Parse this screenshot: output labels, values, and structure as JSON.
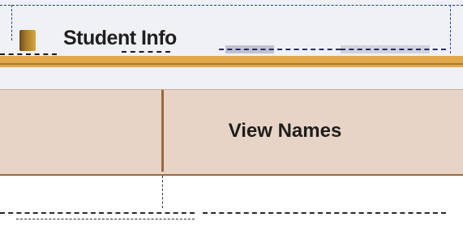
{
  "window": {
    "title": "Student Info"
  },
  "tabs": [
    {
      "label": ""
    },
    {
      "label": "View Names"
    }
  ],
  "colors": {
    "title_background": "#f0f1f5",
    "accent_bar": "#e2a84b",
    "tab_background": "#e8d4c6",
    "tab_border": "#9a6a3d"
  },
  "icons": {
    "app": "folder-icon"
  }
}
